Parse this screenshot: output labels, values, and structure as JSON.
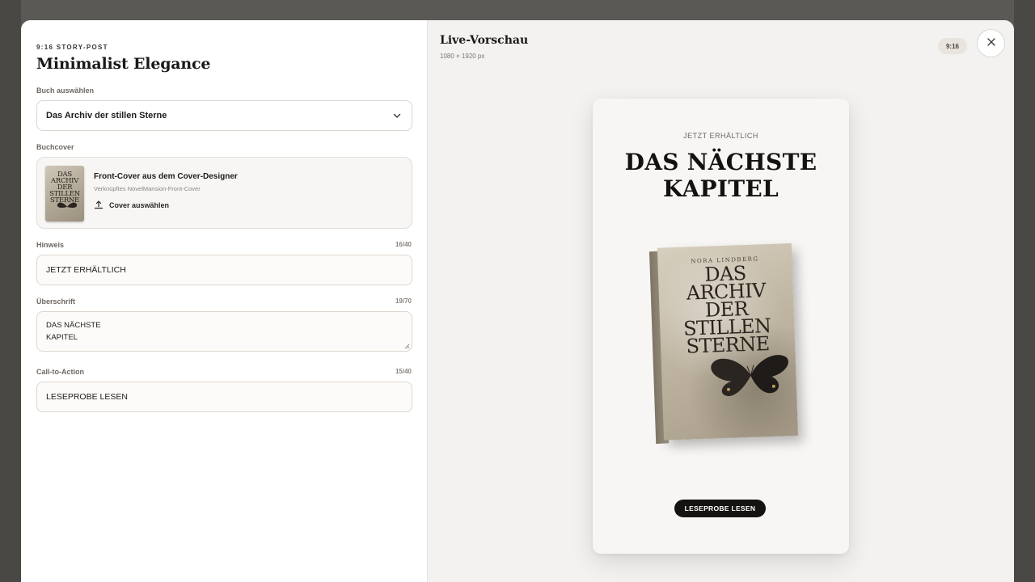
{
  "editor": {
    "eyebrow": "9:16 STORY-POST",
    "title": "Minimalist Elegance",
    "book_select": {
      "label": "Buch auswählen",
      "value": "Das Archiv der stillen Sterne",
      "icon": "chevron-down-icon"
    },
    "cover": {
      "label": "Buchcover",
      "heading": "Front-Cover aus dem Cover-Designer",
      "subtext": "Verknüpftes NovelMansion-Front-Cover",
      "action_label": "Cover auswählen",
      "action_icon": "upload-icon",
      "thumb_title_lines": [
        "DAS",
        "ARCHIV",
        "DER",
        "STILLEN",
        "STERNE"
      ]
    },
    "hint": {
      "label": "Hinweis",
      "counter": "16/40",
      "value": "JETZT ERHÄLTLICH"
    },
    "headline": {
      "label": "Überschrift",
      "counter": "19/70",
      "line1": "DAS NÄCHSTE",
      "line2": "KAPITEL"
    },
    "cta": {
      "label": "Call-to-Action",
      "counter": "15/40",
      "value": "LESEPROBE LESEN"
    }
  },
  "preview": {
    "title": "Live-Vorschau",
    "dimensions": "1080 × 1920 px",
    "ratio_badge": "9:16",
    "close_icon": "close-icon",
    "story": {
      "kicker": "JETZT ERHÄLTLICH",
      "headline_line1": "DAS NÄCHSTE",
      "headline_line2": "KAPITEL",
      "book_author": "NORA LINDBERG",
      "book_title_lines": [
        "DAS",
        "ARCHIV",
        "DER",
        "STILLEN",
        "STERNE"
      ],
      "cta": "LESEPROBE LESEN"
    }
  },
  "colors": {
    "backdrop": "#5b5956",
    "preview_bg": "#f3f2f0",
    "story_bg": "#f7f6f4",
    "cta_bg": "#151311",
    "badge_bg": "#e9e4de"
  }
}
